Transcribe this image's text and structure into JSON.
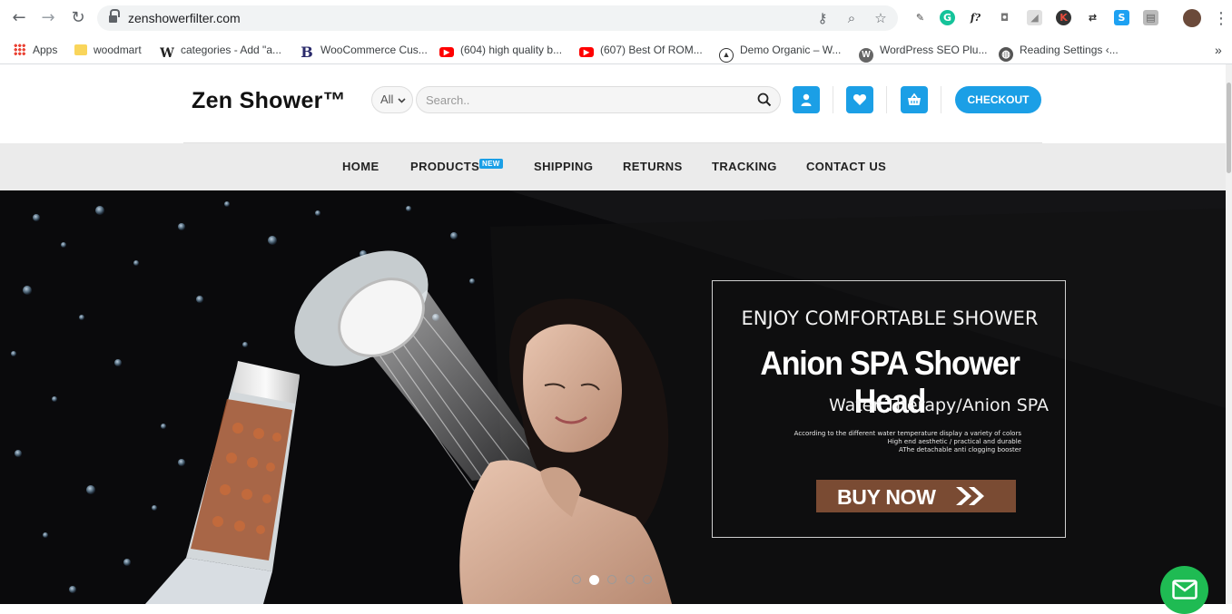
{
  "browser": {
    "url": "zenshowerfilter.com",
    "bookmarks": [
      {
        "label": "Apps",
        "icon": "apps-grid-icon"
      },
      {
        "label": "woodmart",
        "icon": "folder-icon"
      },
      {
        "label": "categories - Add \"a...",
        "icon": "wikipedia-icon"
      },
      {
        "label": "WooCommerce Cus...",
        "icon": "b-logo-icon"
      },
      {
        "label": "(604) high quality b...",
        "icon": "youtube-icon"
      },
      {
        "label": "(607) Best Of ROM...",
        "icon": "youtube-icon"
      },
      {
        "label": "Demo Organic – W...",
        "icon": "triangle-logo-icon"
      },
      {
        "label": "WordPress SEO Plu...",
        "icon": "wordpress-icon"
      },
      {
        "label": "Reading Settings ‹...",
        "icon": "globe-icon"
      }
    ],
    "more_bookmarks": "»"
  },
  "site": {
    "logo": "Zen Shower™",
    "category_select": "All",
    "search_placeholder": "Search..",
    "checkout_label": "CHECKOUT",
    "nav": [
      "HOME",
      "PRODUCTS",
      "SHIPPING",
      "RETURNS",
      "TRACKING",
      "CONTACT US"
    ],
    "new_badge": "NEW"
  },
  "hero": {
    "tagline": "ENJOY COMFORTABLE SHOWER",
    "title": "Anion SPA Shower Head",
    "subtitle": "Water Therapy/Anion SPA",
    "notes": [
      "According to the different water temperature display a variety of colors",
      "High end aesthetic / practical and durable",
      "AThe detachable anti clogging booster"
    ],
    "cta": "BUY NOW",
    "slide_count": 5,
    "active_slide": 2
  },
  "colors": {
    "accent": "#1b9fe6",
    "cta_bg": "#7a4b33",
    "fab": "#1fbb53"
  }
}
